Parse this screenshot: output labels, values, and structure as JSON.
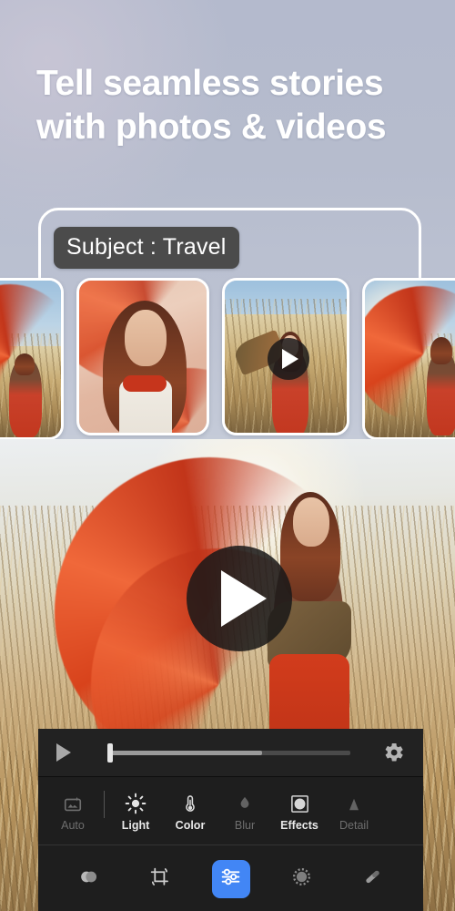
{
  "app": {
    "headline_line1": "Tell seamless stories",
    "headline_line2": "with photos & videos"
  },
  "card": {
    "subject_chip": "Subject : Travel"
  },
  "filmstrip": {
    "items": [
      {
        "name": "thumbnail-1",
        "has_play": false,
        "alt": "woman with red scarf in dry reed field"
      },
      {
        "name": "thumbnail-2",
        "has_play": false,
        "alt": "close-up portrait of woman with long auburn hair"
      },
      {
        "name": "thumbnail-3",
        "has_play": true,
        "alt": "woman posing in tall golden reeds"
      },
      {
        "name": "thumbnail-4",
        "has_play": false,
        "alt": "woman swirling red fabric in sunlit field"
      }
    ]
  },
  "hero": {
    "alt": "woman swirling red scarf in sunlit reed field",
    "play_icon": "play-icon"
  },
  "player": {
    "play_icon": "play-icon",
    "settings_icon": "gear-icon",
    "progress_percent": 0,
    "buffered_percent": 63
  },
  "tools": {
    "items": [
      {
        "label": "Auto",
        "icon": "auto-enhance-icon",
        "enabled": false
      },
      {
        "label": "Light",
        "icon": "sun-icon",
        "enabled": true
      },
      {
        "label": "Color",
        "icon": "thermometer-icon",
        "enabled": true
      },
      {
        "label": "Blur",
        "icon": "droplet-icon",
        "enabled": false
      },
      {
        "label": "Effects",
        "icon": "vignette-icon",
        "enabled": true
      },
      {
        "label": "Detail",
        "icon": "triangle-icon",
        "enabled": false
      }
    ]
  },
  "bottom_nav": {
    "items": [
      {
        "name": "presets",
        "icon": "presets-icon",
        "active": false
      },
      {
        "name": "crop",
        "icon": "crop-icon",
        "active": false
      },
      {
        "name": "adjust",
        "icon": "sliders-icon",
        "active": true
      },
      {
        "name": "retouch",
        "icon": "retouch-icon",
        "active": false
      },
      {
        "name": "healing",
        "icon": "healing-brush-icon",
        "active": false
      }
    ]
  },
  "colors": {
    "accent": "#4286f5",
    "panel": "#1e1e1e",
    "chip_bg": "#4b4b4b",
    "headline": "#ffffff",
    "background_top": "#b4bacd"
  }
}
